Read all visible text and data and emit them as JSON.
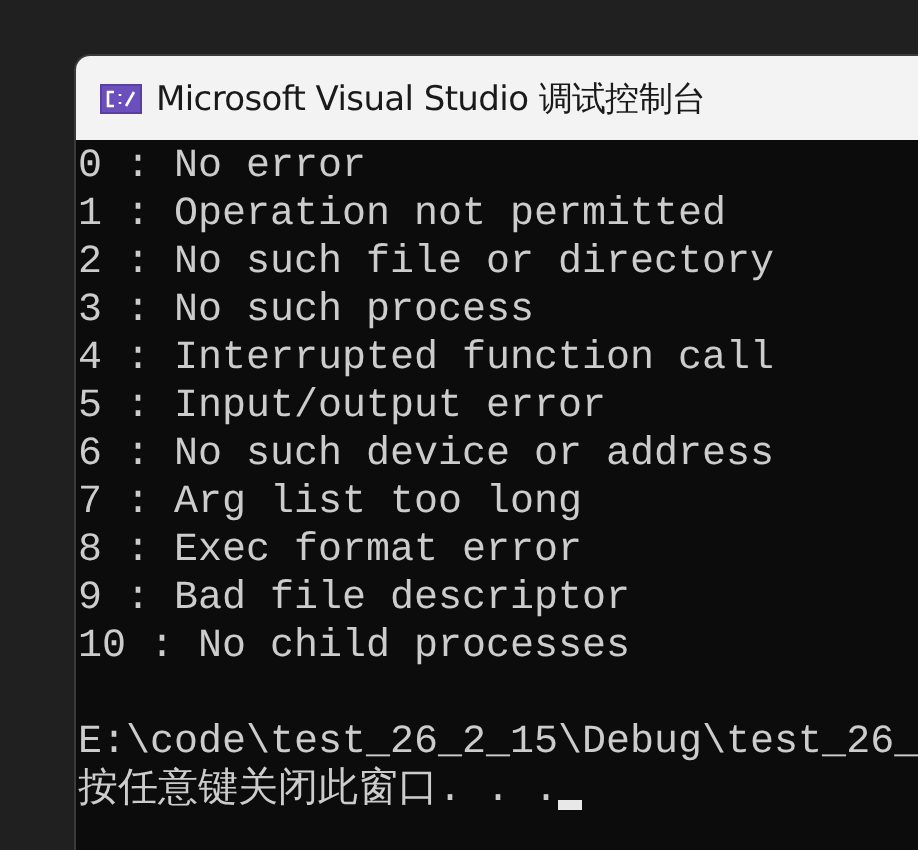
{
  "window": {
    "title": "Microsoft Visual Studio 调试控制台"
  },
  "console": {
    "output_lines": [
      "0 : No error",
      "1 : Operation not permitted",
      "2 : No such file or directory",
      "3 : No such process",
      "4 : Interrupted function call",
      "5 : Input/output error",
      "6 : No such device or address",
      "7 : Arg list too long",
      "8 : Exec format error",
      "9 : Bad file descriptor",
      "10 : No child processes"
    ],
    "path_line": "E:\\code\\test_26_2_15\\Debug\\test_26_",
    "prompt_line": "按任意键关闭此窗口. . ."
  }
}
